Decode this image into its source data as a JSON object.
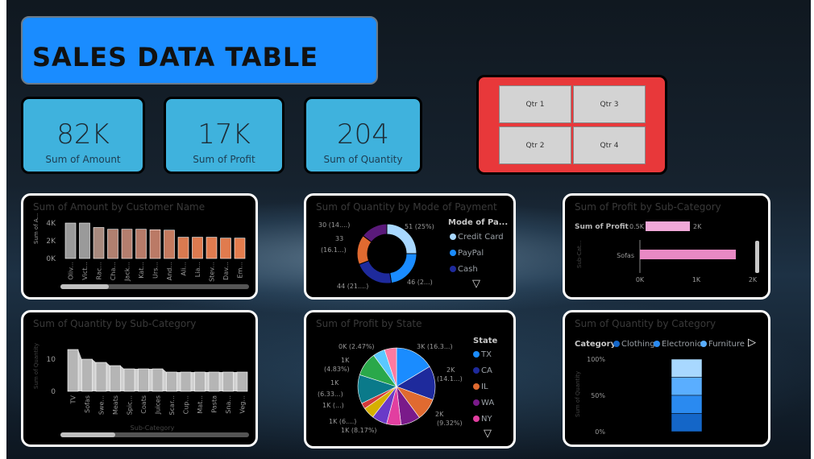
{
  "page": {
    "title": "SALES DATA TABLE"
  },
  "kpis": [
    {
      "value": "82K",
      "label": "Sum of Amount"
    },
    {
      "value": "17K",
      "label": "Sum of Profit"
    },
    {
      "value": "204",
      "label": "Sum of Quantity"
    }
  ],
  "slicer": {
    "buttons": [
      "Qtr 1",
      "Qtr 3",
      "Qtr 2",
      "Qtr 4"
    ]
  },
  "colors": {
    "title_bg": "#1a8cff",
    "kpi_bg": "#3fb2dd",
    "slicer_bg": "#e8383a",
    "card_bg": "#000000",
    "bar_gray": "#b0b0b0",
    "bar_orange": "#e07b4e",
    "pink": "#e79ac8",
    "teal_blue": "#1a8cff"
  },
  "chart_data": [
    {
      "type": "bar",
      "title": "Sum of Amount by Customer Name",
      "ylabel": "Sum of A...",
      "ylim": [
        0,
        4000
      ],
      "yticks": [
        "0K",
        "2K",
        "4K"
      ],
      "categories": [
        "Oliv...",
        "Vict...",
        "Rac...",
        "Cha...",
        "Jack...",
        "Kat...",
        "Urs...",
        "And...",
        "Ali...",
        "Lia...",
        "Stev...",
        "Dav...",
        "Em..."
      ],
      "values": [
        4000,
        4000,
        3500,
        3300,
        3300,
        3300,
        3250,
        3200,
        2400,
        2400,
        2400,
        2300,
        2300
      ],
      "colors": [
        "#9a9a9a",
        "#9a9a9a",
        "#a88a7e",
        "#b08070",
        "#b47e6e",
        "#b77b69",
        "#bb7a66",
        "#c47a5f",
        "#d97a50",
        "#dc7a4f",
        "#df7b4f",
        "#e07b4e",
        "#e37c4d"
      ]
    },
    {
      "type": "pie",
      "title": "Sum of Quantity by Mode of Payment",
      "legend_title": "Mode of Pa...",
      "legend": [
        "Credit Card",
        "PayPal",
        "Cash"
      ],
      "values": [
        51,
        46,
        44,
        33,
        30
      ],
      "colors": [
        "#a8d8ff",
        "#1a8cff",
        "#1e2a9c",
        "#e06a30",
        "#5a1a7a"
      ],
      "labels": [
        "51 (25%)",
        "46 (2...)",
        "44 (21....)",
        "33",
        "(16.1...)",
        "30 (14....)"
      ]
    },
    {
      "type": "bar",
      "title": "Sum of Profit by Sub-Category",
      "legend": "Sum of Profit",
      "ylabel": "Sub-Cat...",
      "xticks": [
        "0K",
        "1K",
        "2K"
      ],
      "categories": [
        "Sofas"
      ],
      "values": [
        1700
      ],
      "xlim": [
        0,
        2000
      ],
      "legend_scale": [
        "0.5K",
        "2K"
      ]
    },
    {
      "type": "area",
      "title": "Sum of Quantity by Sub-Category",
      "ylabel": "Sum of Quantity",
      "xlabel": "Sub-Category",
      "yticks": [
        "0",
        "10"
      ],
      "categories": [
        "TV",
        "Sofas",
        "Swe...",
        "Meats",
        "Spic...",
        "Coats",
        "Juices",
        "Scar...",
        "Cup...",
        "Mat...",
        "Pasta",
        "Sna...",
        "Veg..."
      ],
      "values": [
        13,
        10,
        9,
        8,
        7,
        7,
        7,
        6,
        6,
        6,
        6,
        6,
        6
      ]
    },
    {
      "type": "pie",
      "title": "Sum of Profit by State",
      "legend_title": "State",
      "legend": [
        "TX",
        "CA",
        "IL",
        "WA",
        "NY"
      ],
      "values": [
        16.3,
        14.1,
        9.32,
        8.17,
        6,
        6.33,
        4.83,
        2.47,
        12,
        10,
        5,
        5
      ],
      "colors": [
        "#1a8cff",
        "#1e2a9c",
        "#e06a30",
        "#7a1a8a",
        "#e23fa0",
        "#6a3ac8",
        "#d6b000",
        "#d23a3a",
        "#0a7a8a",
        "#2aa84a",
        "#5ac8ff",
        "#ff7aa0"
      ],
      "labels": [
        "3K (16.3...)",
        "2K",
        "(14.1...)",
        "2K",
        "(9.32%)",
        "1K (8.17%)",
        "1K (6....)",
        "1K (...)",
        "(6.33...)",
        "1K",
        "(4.83%)",
        "1K",
        "0K (2.47%)"
      ]
    },
    {
      "type": "bar",
      "title": "Sum of Quantity by Category",
      "legend_title": "Category",
      "legend": [
        "Clothing",
        "Electronics",
        "Furniture"
      ],
      "ylabel": "Sum of Quantity",
      "yticks": [
        "0%",
        "50%",
        "100%"
      ],
      "segments": [
        0.25,
        0.25,
        0.25,
        0.25
      ],
      "colors": [
        "#a8d8ff",
        "#5aaeff",
        "#2a8af0",
        "#1466c8"
      ]
    }
  ]
}
